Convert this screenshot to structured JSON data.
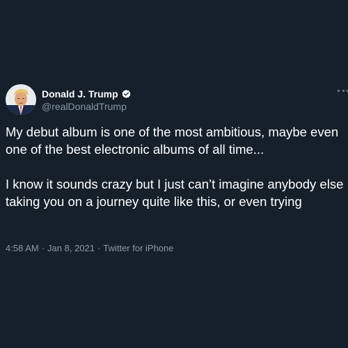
{
  "tweet": {
    "author": {
      "display_name": "Donald J. Trump",
      "handle": "@realDonaldTrump",
      "verified": true
    },
    "paragraphs": [
      "My debut album is one of the most ambitious, maybe even one of the best electronic albums of all time...",
      "I know it sounds crazy but I just can’t imagine anybody else taking you on a journey quite like this, or even trying"
    ],
    "meta": {
      "time": "4:58 AM",
      "separator": "·",
      "date": "Jan 8, 2021",
      "source": "Twitter for iPhone"
    }
  },
  "icons": {
    "more": "more-horizontal-icon",
    "verified": "verified-badge-icon"
  },
  "colors": {
    "background": "#15202b",
    "text_primary": "#ffffff",
    "text_secondary": "#8899a6",
    "verified_badge": "#ffffff"
  }
}
